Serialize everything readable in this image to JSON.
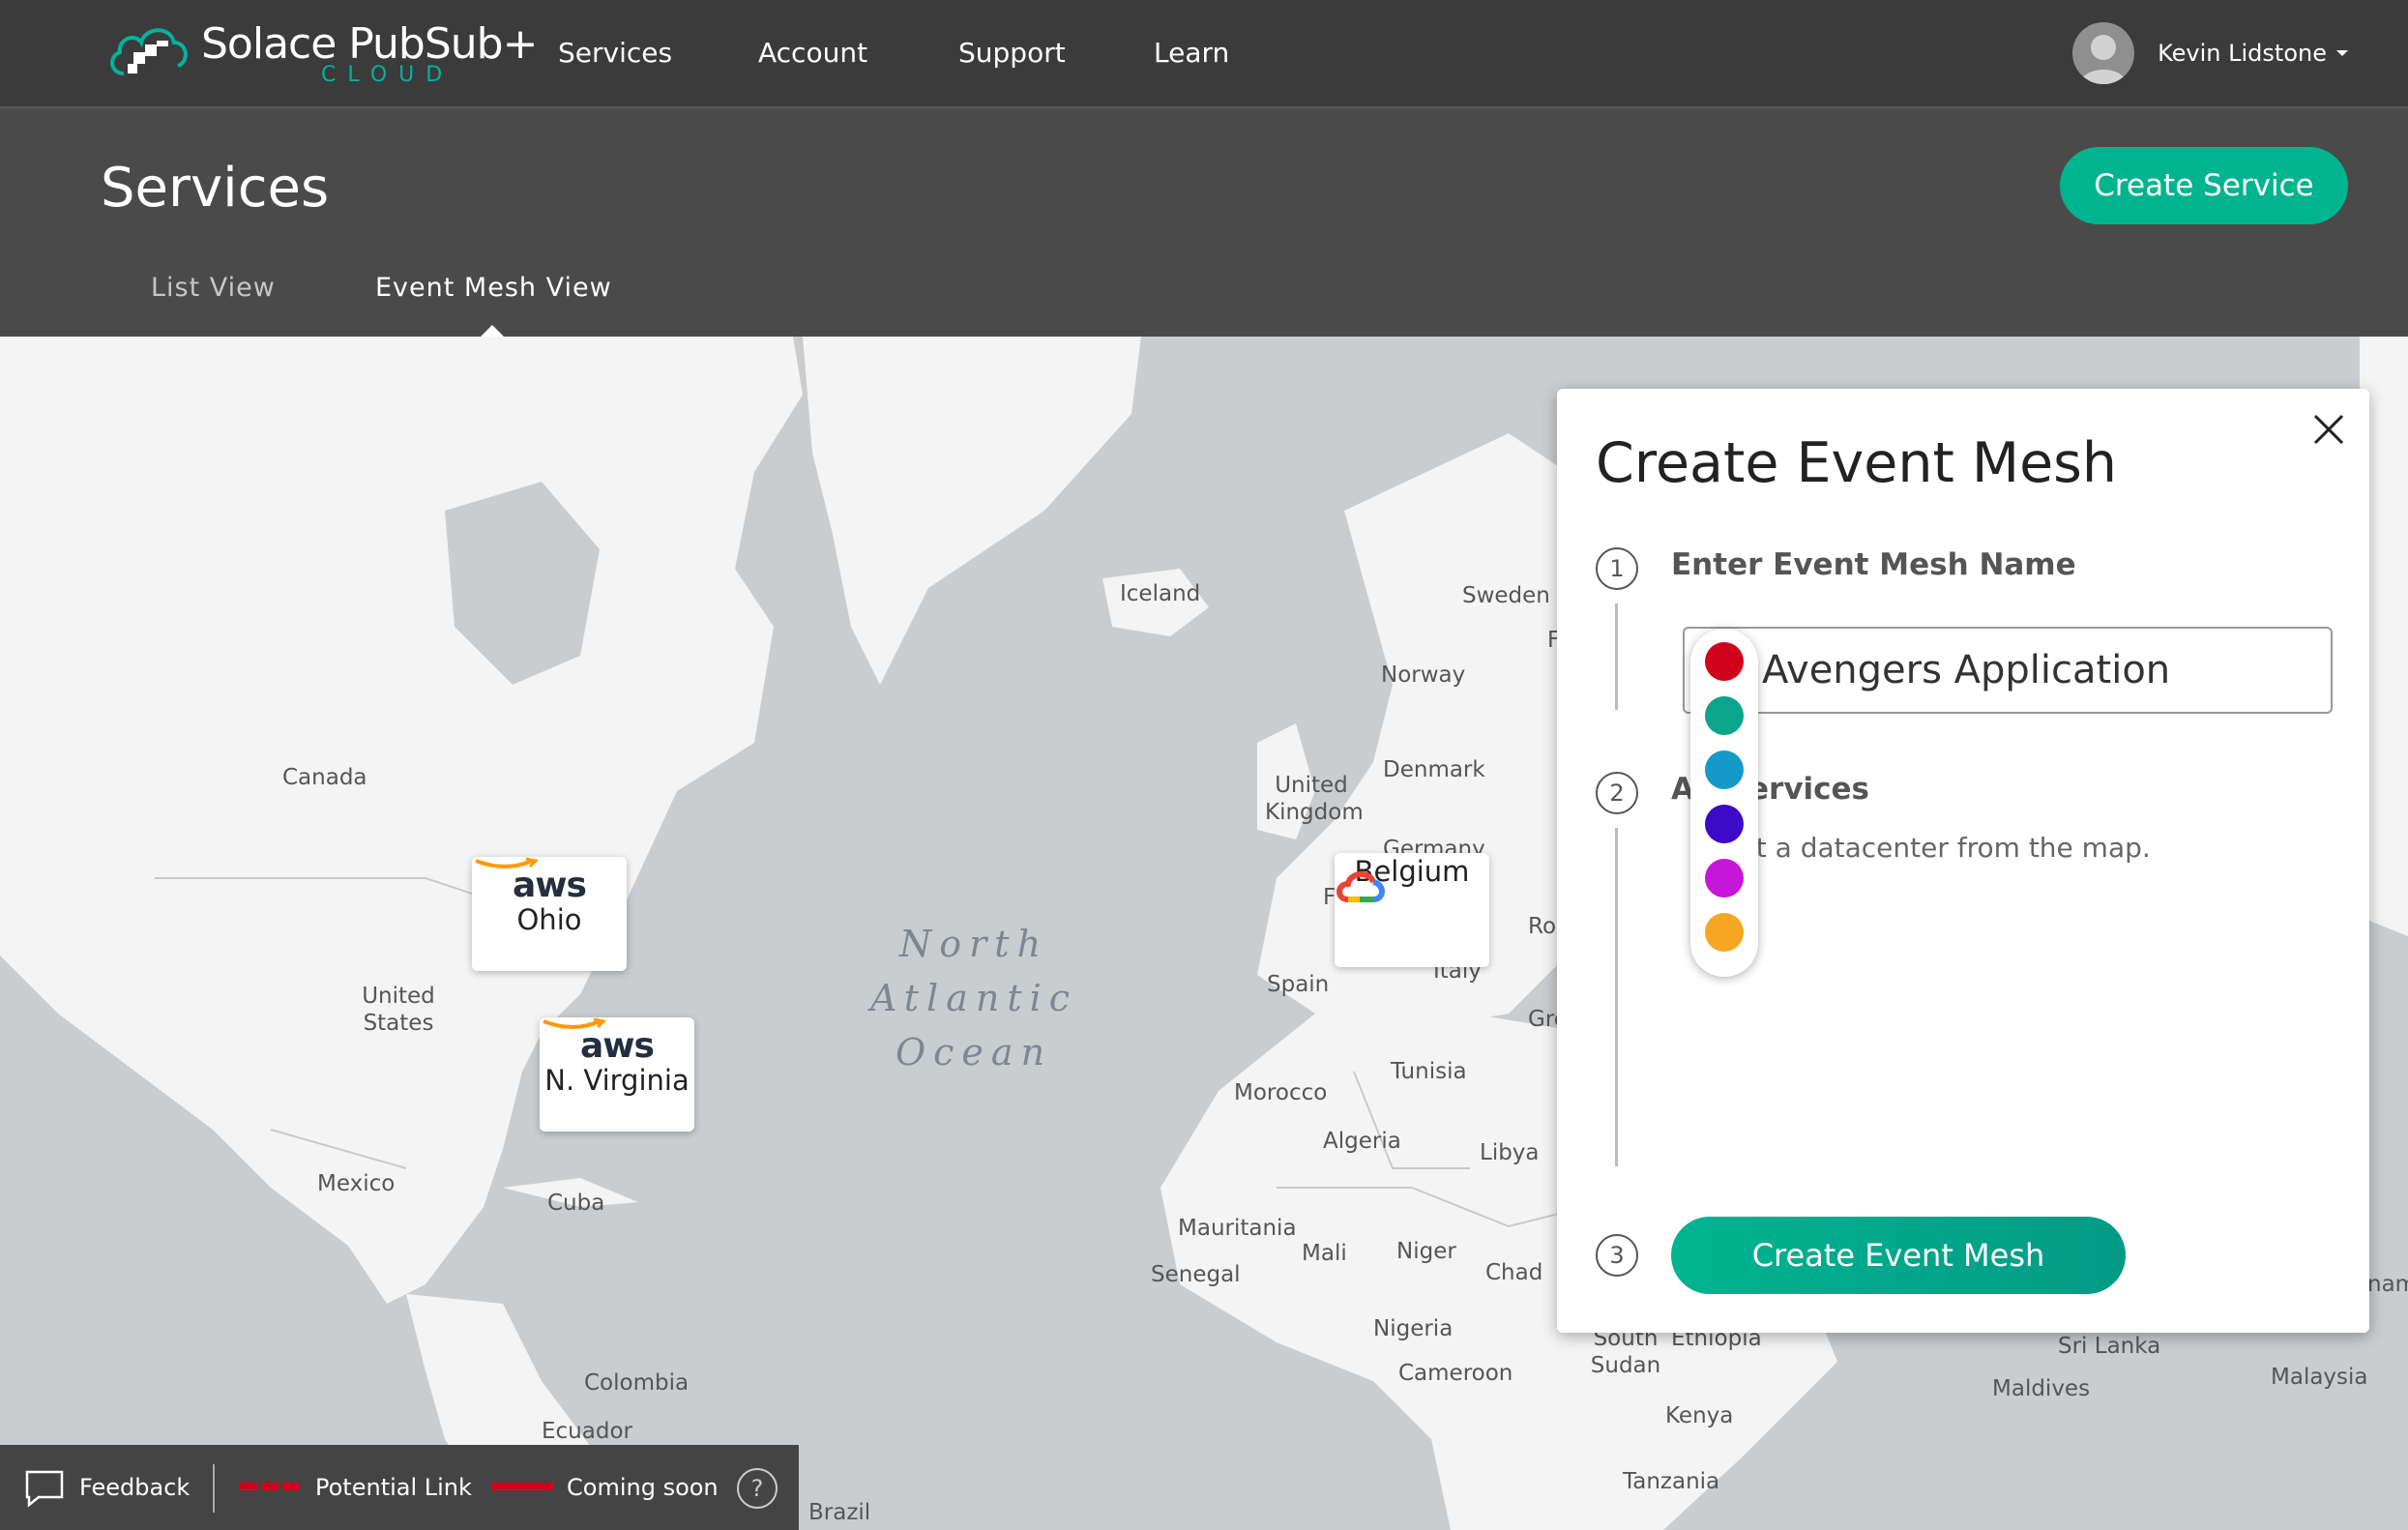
{
  "brand": {
    "name": "Solace PubSub+",
    "sub": "CLOUD"
  },
  "nav": {
    "items": [
      {
        "label": "Services"
      },
      {
        "label": "Account"
      },
      {
        "label": "Support"
      },
      {
        "label": "Learn"
      }
    ],
    "user": {
      "name": "Kevin Lidstone"
    }
  },
  "header": {
    "title": "Services",
    "create_button": "Create Service",
    "tabs": [
      {
        "label": "List View",
        "active": false
      },
      {
        "label": "Event Mesh View",
        "active": true
      }
    ]
  },
  "map": {
    "ocean_label": [
      "North",
      "Atlantic",
      "Ocean"
    ],
    "places": [
      "Canada",
      "United States",
      "Mexico",
      "Cuba",
      "Colombia",
      "Ecuador",
      "Brazil",
      "Iceland",
      "Norway",
      "Sweden",
      "Denmark",
      "United Kingdom",
      "Germany",
      "Spain",
      "Italy",
      "Morocco",
      "Algeria",
      "Tunisia",
      "Libya",
      "Mauritania",
      "Mali",
      "Niger",
      "Chad",
      "Senegal",
      "Nigeria",
      "Cameroon",
      "South Sudan",
      "Ethiopia",
      "Kenya",
      "Tanzania",
      "Sri Lanka",
      "Maldives",
      "Malaysia"
    ],
    "fragments": [
      "F",
      "F",
      "Ro",
      "Gre",
      "nam"
    ],
    "datacenters": [
      {
        "provider": "aws",
        "label": "Ohio"
      },
      {
        "provider": "aws",
        "label": "N. Virginia"
      },
      {
        "provider": "google-cloud",
        "label": "Belgium"
      }
    ]
  },
  "panel": {
    "title": "Create Event Mesh",
    "close_label": "X",
    "step1": {
      "number": "1",
      "title": "Enter Event Mesh Name",
      "input_value": "Avengers Application"
    },
    "step2": {
      "number": "2",
      "title": "Add Services",
      "visible_title": "A",
      "visible_title_rest": "ervices",
      "hint": "Select a datacenter from the map.",
      "visible_hint_start": "S",
      "visible_hint_rest": "t a datacenter from the map."
    },
    "step3": {
      "number": "3",
      "button": "Create Event Mesh"
    },
    "color_options": [
      {
        "name": "red",
        "hex": "#d0021b",
        "selected": true
      },
      {
        "name": "teal",
        "hex": "#0aa58a",
        "selected": false
      },
      {
        "name": "blue",
        "hex": "#1599c8",
        "selected": false
      },
      {
        "name": "indigo",
        "hex": "#3b0bc7",
        "selected": false
      },
      {
        "name": "magenta",
        "hex": "#c616d8",
        "selected": false
      },
      {
        "name": "orange",
        "hex": "#f5a623",
        "selected": false
      }
    ]
  },
  "legend": {
    "feedback": "Feedback",
    "items": [
      {
        "label": "Potential Link",
        "color": "#d0021b"
      },
      {
        "label": "Coming soon",
        "color": "#d0021b"
      }
    ],
    "help": "?"
  },
  "colors": {
    "accent": "#00b490",
    "nav_bg": "#3b3b3b",
    "subheader_bg": "#4a4a4a"
  }
}
